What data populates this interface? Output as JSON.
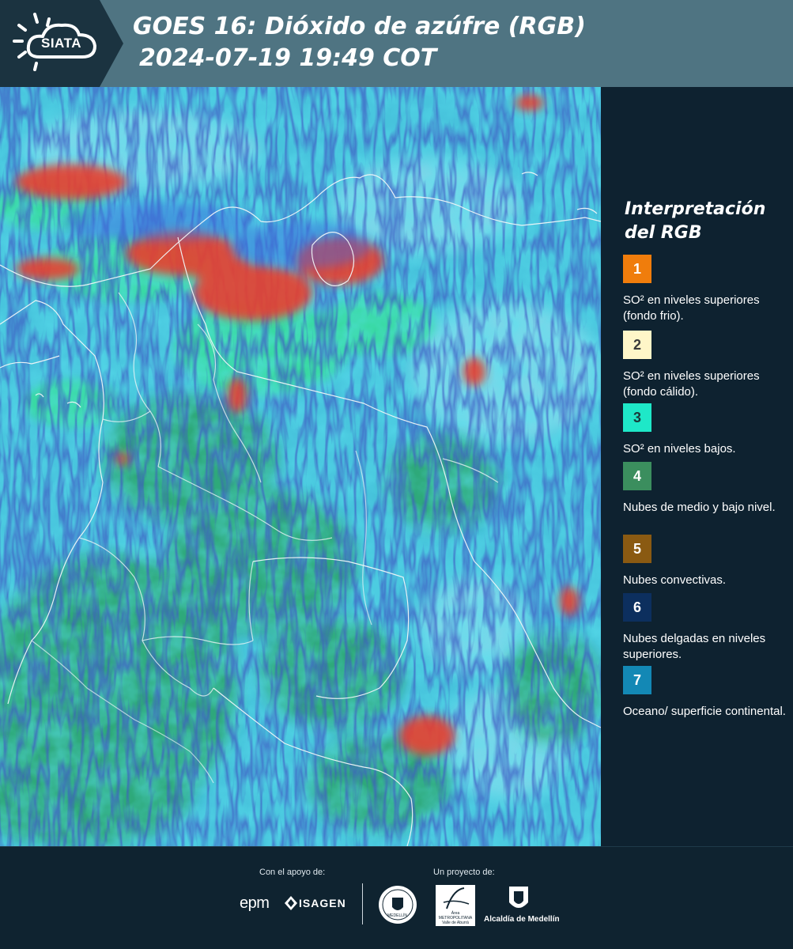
{
  "header": {
    "logo_text": "SIATA",
    "title_line1": "GOES 16: Dióxido de azúfre (RGB)",
    "title_line2": "2024-07-19 19:49 COT"
  },
  "legend": {
    "title": "Interpretación del RGB",
    "items": [
      {
        "number": "1",
        "color": "#f07d0c",
        "label": "SO² en niveles superiores (fondo frio)."
      },
      {
        "number": "2",
        "color": "#fff6c8",
        "label": "SO² en niveles superiores (fondo cálido)."
      },
      {
        "number": "3",
        "color": "#1ee8c8",
        "label": "SO² en niveles bajos."
      },
      {
        "number": "4",
        "color": "#3b8e5e",
        "label": "Nubes de medio y bajo nivel."
      },
      {
        "number": "5",
        "color": "#8a5a12",
        "label": "Nubes convectivas."
      },
      {
        "number": "6",
        "color": "#0c2f5e",
        "label": "Nubes delgadas en niveles superiores."
      },
      {
        "number": "7",
        "color": "#1388b5",
        "label": "Oceano/ superficie continental."
      }
    ]
  },
  "footer": {
    "support_caption": "Con el apoyo de:",
    "project_caption": "Un proyecto de:",
    "support_partners": [
      "epm",
      "ISAGEN"
    ],
    "project_partners": [
      "MEDELLÍN",
      "Área METROPOLITANA Valle de Aburrá",
      "Alcaldía de Medellín"
    ]
  }
}
